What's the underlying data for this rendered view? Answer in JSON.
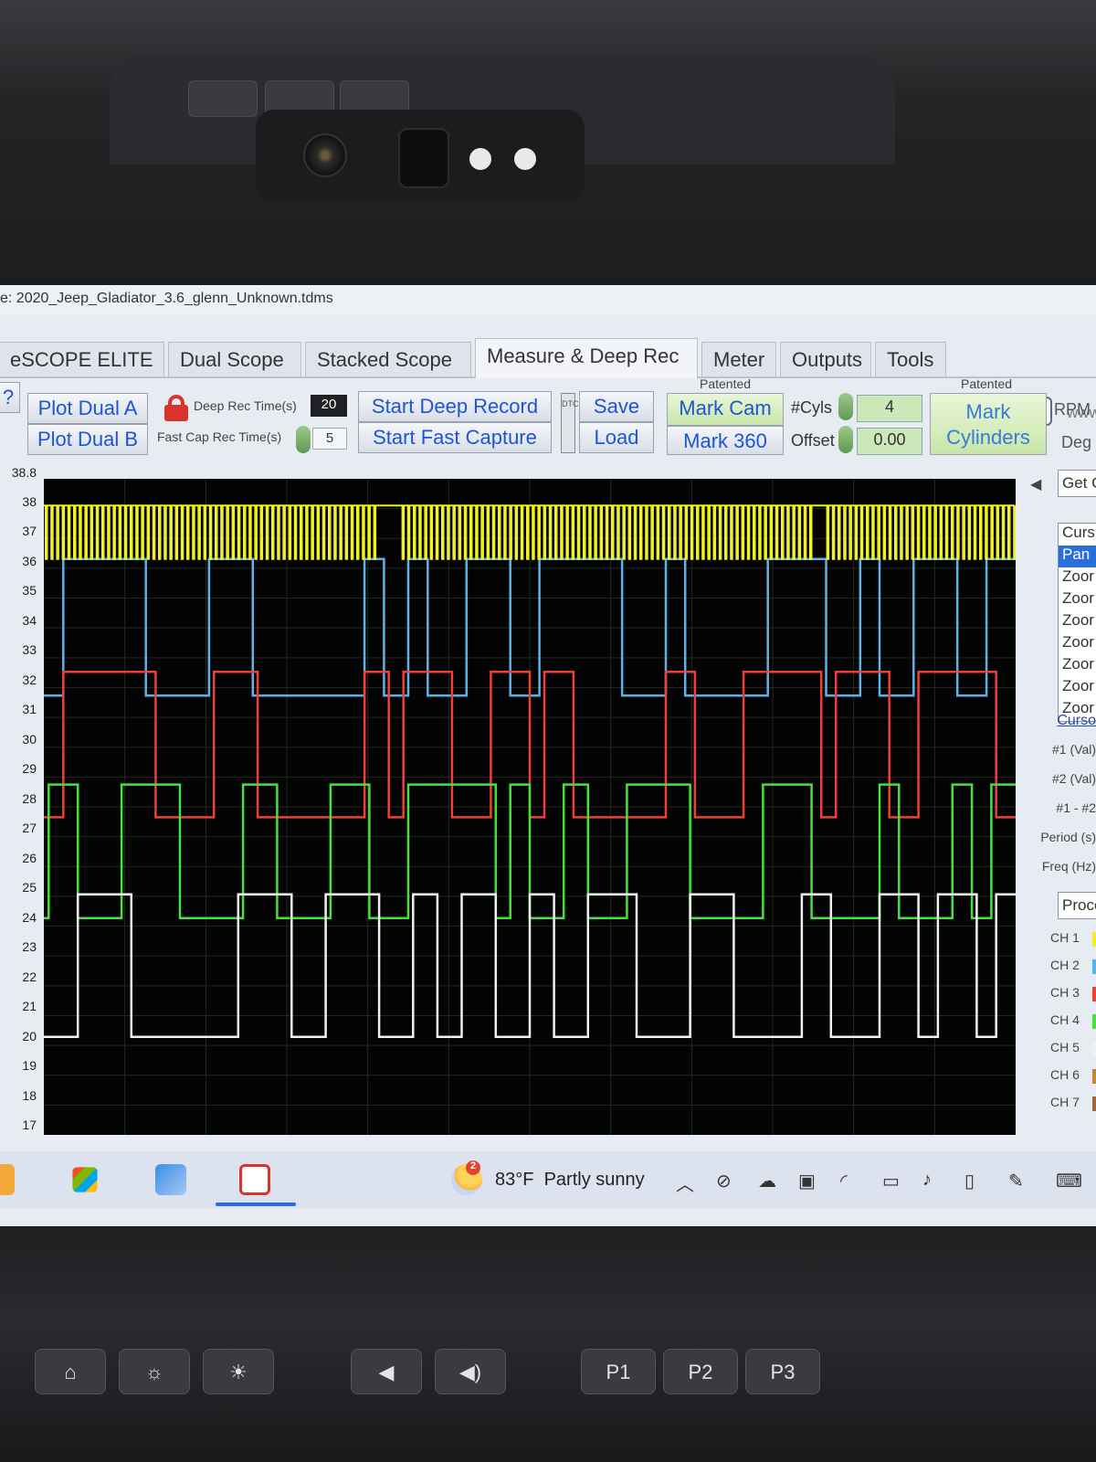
{
  "window": {
    "title": "e: 2020_Jeep_Gladiator_3.6_glenn_Unknown.tdms"
  },
  "tabs": [
    {
      "label": "eSCOPE ELITE"
    },
    {
      "label": "Dual Scope"
    },
    {
      "label": "Stacked Scope"
    },
    {
      "label": "Measure & Deep Rec",
      "active": true
    },
    {
      "label": "Meter"
    },
    {
      "label": "Outputs"
    },
    {
      "label": "Tools"
    }
  ],
  "tabs_extra": {
    "www": "www"
  },
  "toolbar": {
    "help": "?",
    "plot_dual_a": "Plot Dual A",
    "plot_dual_b": "Plot Dual B",
    "deep_rec_label": "Deep Rec Time(s)",
    "deep_rec_value": "20",
    "fast_cap_label": "Fast Cap Rec Time(s)",
    "fast_cap_value": "5",
    "start_deep_record": "Start Deep Record",
    "start_fast_capture": "Start Fast Capture",
    "dtc": "DTC",
    "save": "Save",
    "load": "Load",
    "patented_1": "Patented",
    "mark_cam": "Mark Cam",
    "mark_360": "Mark 360",
    "cyls_label": "#Cyls",
    "cyls_value": "4",
    "offset_label": "Offset",
    "offset_value": "0.00",
    "patented_2": "Patented",
    "mark_cylinders_1": "Mark",
    "mark_cylinders_2": "Cylinders",
    "rpm": "RPM",
    "deg": "Deg"
  },
  "y_axis": {
    "top_label": "38.8",
    "ticks": [
      "38",
      "37",
      "36",
      "35",
      "34",
      "33",
      "32",
      "31",
      "30",
      "29",
      "28",
      "27",
      "26",
      "25",
      "24",
      "23",
      "22",
      "21",
      "20",
      "19",
      "18",
      "17"
    ],
    "ymin": 16.7,
    "ymax": 38.8
  },
  "traces": {
    "colors": {
      "yellow": "#f0f028",
      "blue": "#5ab4ea",
      "red": "#ee4034",
      "green": "#46e23a",
      "white": "#f0f0f0"
    },
    "blue": {
      "high": 36.1,
      "low": 31.5,
      "transitions": [
        0.02,
        0.105,
        0.17,
        0.215,
        0.33,
        0.35,
        0.375,
        0.395,
        0.435,
        0.48,
        0.51,
        0.595,
        0.64,
        0.66,
        0.745,
        0.805,
        0.84,
        0.86,
        0.895,
        0.94,
        0.97
      ]
    },
    "red": {
      "high": 32.3,
      "low": 27.4,
      "transitions": [
        0.02,
        0.115,
        0.175,
        0.22,
        0.33,
        0.355,
        0.37,
        0.42,
        0.46,
        0.5,
        0.515,
        0.545,
        0.64,
        0.67,
        0.72,
        0.8,
        0.815,
        0.87,
        0.9,
        0.98
      ]
    },
    "green": {
      "high": 28.5,
      "low": 24.0,
      "transitions": [
        0.005,
        0.035,
        0.08,
        0.14,
        0.205,
        0.24,
        0.295,
        0.335,
        0.375,
        0.465,
        0.48,
        0.5,
        0.535,
        0.56,
        0.6,
        0.665,
        0.74,
        0.79,
        0.86,
        0.88,
        0.935,
        0.955,
        0.975
      ]
    },
    "white": {
      "high": 24.8,
      "low": 20.0,
      "transitions": [
        0.035,
        0.09,
        0.2,
        0.255,
        0.29,
        0.345,
        0.38,
        0.405,
        0.43,
        0.465,
        0.5,
        0.525,
        0.56,
        0.61,
        0.665,
        0.71,
        0.78,
        0.81,
        0.86,
        0.9,
        0.92,
        0.96,
        0.98
      ]
    },
    "yellow": {
      "high": 37.9,
      "low": 36.1,
      "gaps": [
        0.345,
        0.365,
        0.79,
        0.805
      ]
    }
  },
  "right_panel": {
    "get": "Get C",
    "list": [
      "Curs",
      "Pan",
      "Zoor",
      "Zoor",
      "Zoor",
      "Zoor",
      "Zoor",
      "Zoor",
      "Zoor"
    ],
    "cursor_header": "Curso",
    "readouts": [
      "#1 (Val)",
      "#2 (Val)",
      "#1 - #2",
      "Period (s)",
      "Freq (Hz)"
    ],
    "proc": "Proce",
    "channels": [
      "CH 1",
      "CH 2",
      "CH 3",
      "CH 4",
      "CH 5",
      "CH 6",
      "CH 7"
    ]
  },
  "taskbar": {
    "temperature": "83°F",
    "weather": "Partly sunny",
    "badge": "2"
  },
  "hardware_buttons": {
    "p1": "P1",
    "p2": "P2",
    "p3": "P3"
  }
}
